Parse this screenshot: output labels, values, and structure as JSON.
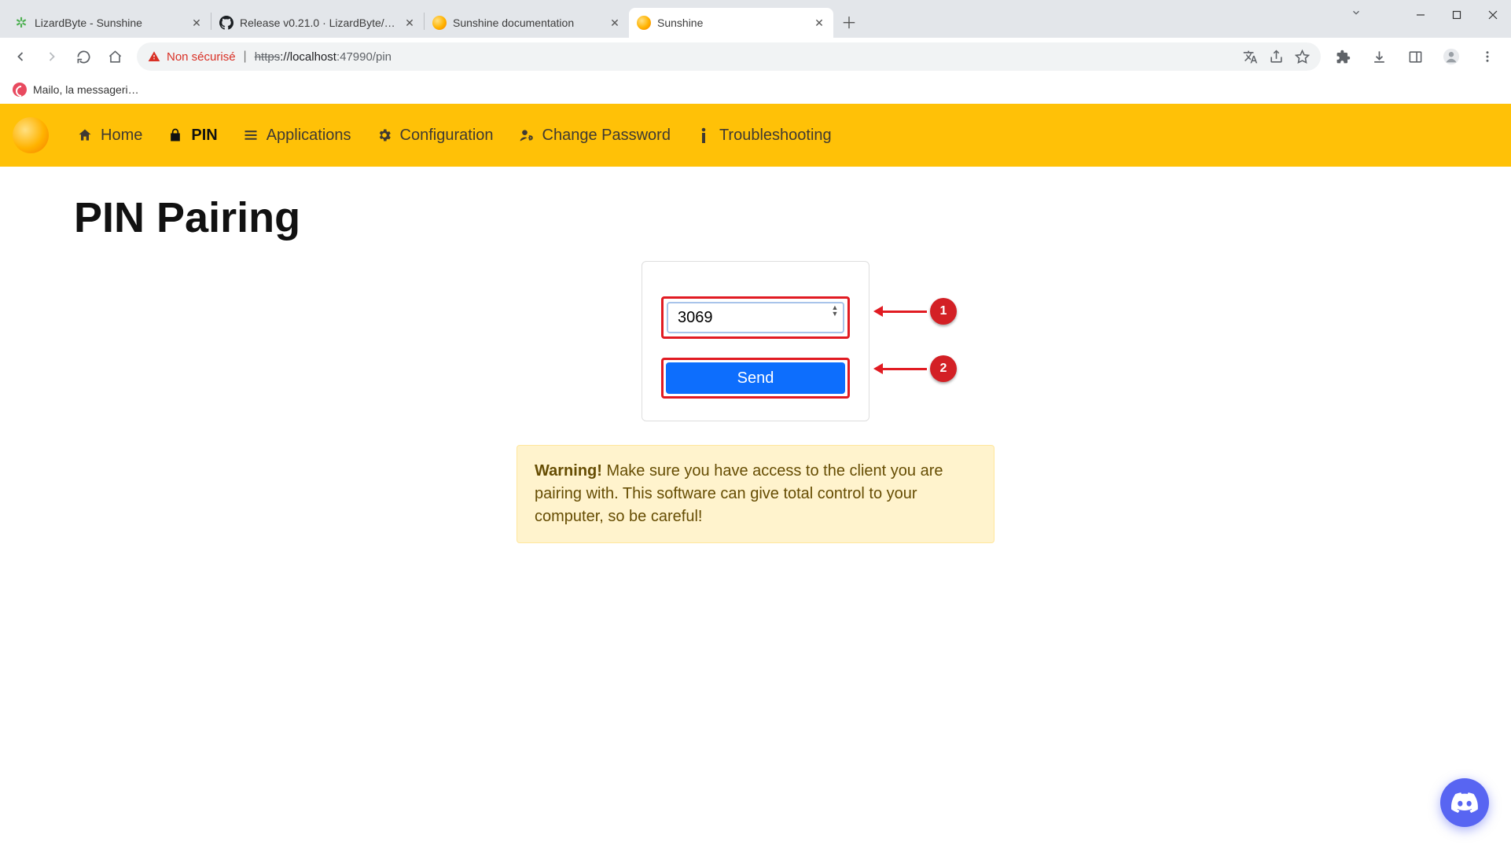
{
  "browser": {
    "tabs": [
      {
        "title": "LizardByte - Sunshine",
        "icon": "lizard"
      },
      {
        "title": "Release v0.21.0 · LizardByte/Sun",
        "icon": "github"
      },
      {
        "title": "Sunshine documentation",
        "icon": "sunshine"
      },
      {
        "title": "Sunshine",
        "icon": "sunshine",
        "active": true
      }
    ],
    "insecure_label": "Non sécurisé",
    "url_proto": "https",
    "url_host": "://localhost",
    "url_port_path": ":47990/pin",
    "bookmarks": [
      {
        "label": "Mailo, la messageri…"
      }
    ]
  },
  "nav": {
    "items": [
      {
        "icon": "home",
        "label": "Home"
      },
      {
        "icon": "lock",
        "label": "PIN",
        "active": true
      },
      {
        "icon": "list",
        "label": "Applications"
      },
      {
        "icon": "gear",
        "label": "Configuration"
      },
      {
        "icon": "user-gear",
        "label": "Change Password"
      },
      {
        "icon": "info",
        "label": "Troubleshooting"
      }
    ]
  },
  "page": {
    "title": "PIN Pairing",
    "pin_value": "3069",
    "send_label": "Send",
    "annotations": {
      "pin_badge": "1",
      "send_badge": "2"
    },
    "alert_bold": "Warning!",
    "alert_text": " Make sure you have access to the client you are pairing with. This software can give total control to your computer, so be careful!"
  }
}
